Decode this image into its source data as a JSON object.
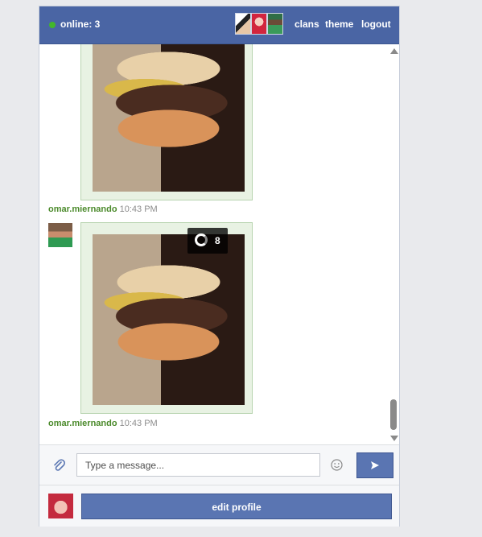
{
  "header": {
    "online_label": "online: 3",
    "links": [
      "clans",
      "theme",
      "logout"
    ],
    "status_color": "#42b72a",
    "bar_color": "#4a65a4"
  },
  "messages": [
    {
      "image_badge_count": "",
      "username": "omar.miernando",
      "time": "10:43 PM"
    },
    {
      "image_badge_count": "8",
      "username": "omar.miernando",
      "time": "10:43 PM"
    }
  ],
  "composer": {
    "placeholder": "Type a message...",
    "attach_icon": "paperclip-icon",
    "emoji_icon": "smiley-icon",
    "send_icon": "send-icon"
  },
  "footer": {
    "edit_profile_label": "edit profile"
  }
}
